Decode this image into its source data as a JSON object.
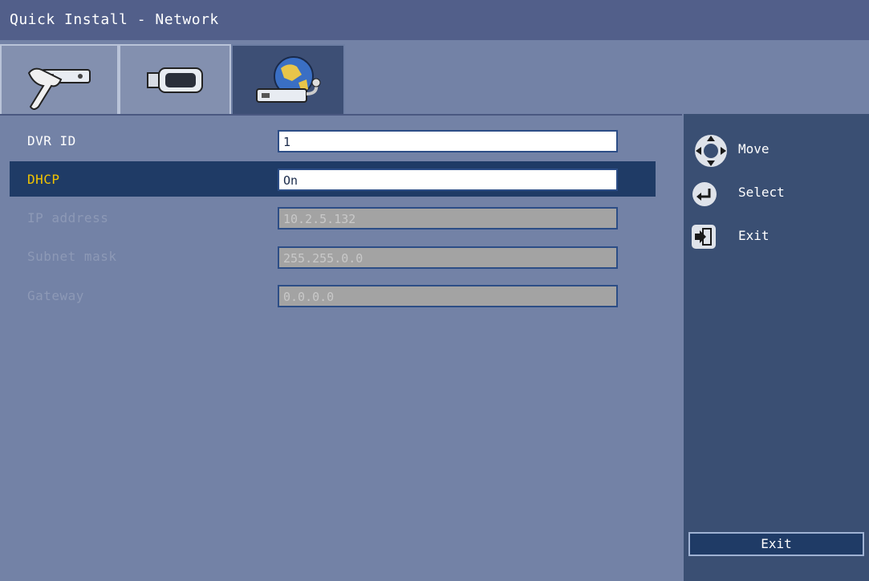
{
  "window": {
    "title": "Quick Install - Network"
  },
  "tabs": [
    {
      "icon": "dvr-settings-icon",
      "active": false
    },
    {
      "icon": "camera-icon",
      "active": false
    },
    {
      "icon": "network-globe-icon",
      "active": true
    }
  ],
  "form": {
    "rows": [
      {
        "label": "DVR ID",
        "value": "1",
        "state": "normal"
      },
      {
        "label": "DHCP",
        "value": "On",
        "state": "selected"
      },
      {
        "label": "IP address",
        "value": "10.2.5.132",
        "state": "disabled"
      },
      {
        "label": "Subnet mask",
        "value": "255.255.0.0",
        "state": "disabled"
      },
      {
        "label": "Gateway",
        "value": "0.0.0.0",
        "state": "disabled"
      }
    ]
  },
  "help": {
    "items": [
      {
        "icon": "dpad-icon",
        "label": "Move"
      },
      {
        "icon": "enter-icon",
        "label": "Select"
      },
      {
        "icon": "exit-icon",
        "label": "Exit"
      }
    ],
    "exit_button": "Exit"
  },
  "colors": {
    "background": "#7382a6",
    "titlebar": "#525f8a",
    "selected_row": "#1f3b66",
    "selected_label": "#f2c400",
    "side_panel": "#3a4f73"
  }
}
